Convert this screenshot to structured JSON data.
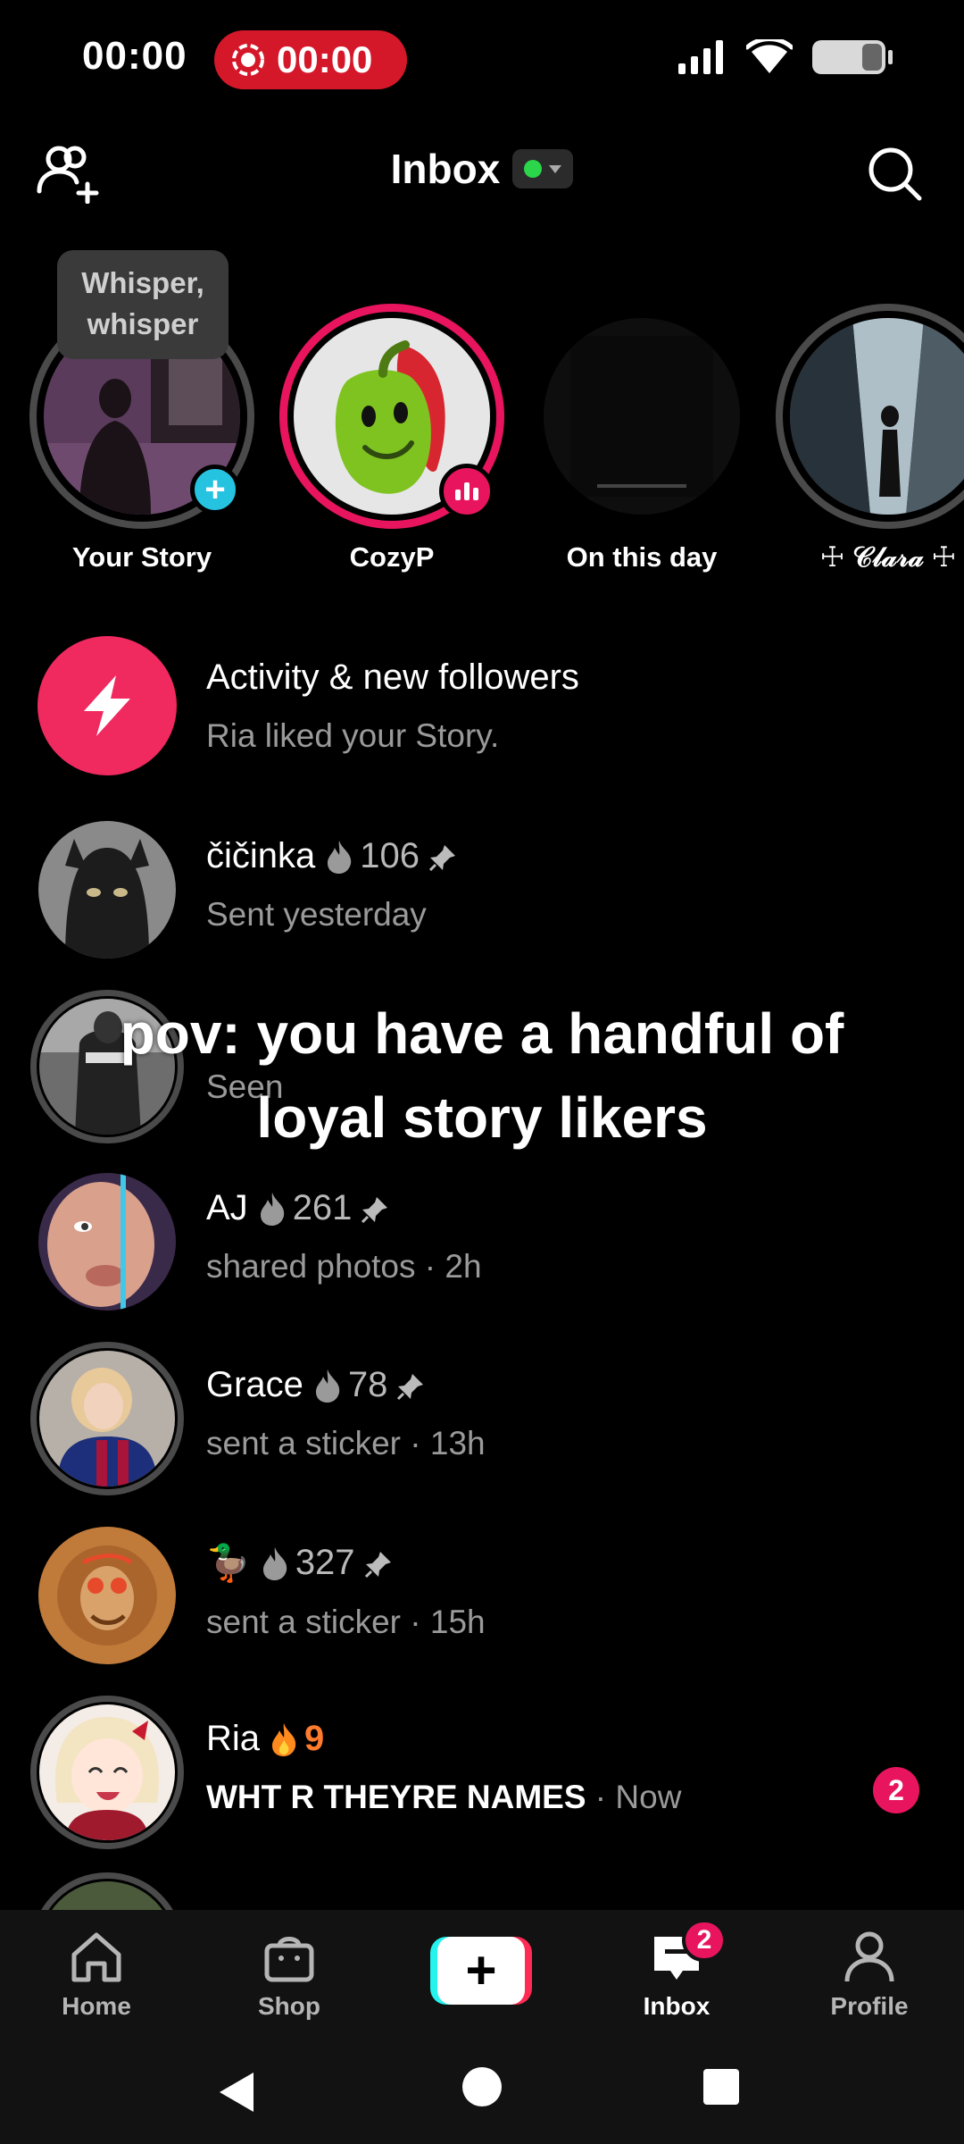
{
  "status_bar": {
    "time": "00:00",
    "recording_time": "00:00",
    "icons": [
      "signal-icon",
      "wifi-icon",
      "battery-icon"
    ]
  },
  "header": {
    "title": "Inbox",
    "status_color": "#2bd64b",
    "icons": [
      "add-friends-icon",
      "search-icon"
    ]
  },
  "stories": {
    "tooltip": "Whisper, whisper",
    "items": [
      {
        "name": "Your Story",
        "ring": "gray"
      },
      {
        "name": "CozyP",
        "ring": "pink"
      },
      {
        "name": "On this day",
        "ring": "none"
      },
      {
        "name": "☩ 𝒞𝓁𝒶𝓇𝒶 ☩",
        "ring": "gray"
      }
    ]
  },
  "activity": {
    "title": "Activity & new followers",
    "subtitle": "Ria liked your Story."
  },
  "conversations": [
    {
      "name": "čičinka",
      "streak": "106",
      "pinned": true,
      "subtitle": "Sent yesterday",
      "time": ""
    },
    {
      "name": "",
      "streak": "",
      "pinned": false,
      "subtitle": "Seen",
      "time": ""
    },
    {
      "name": "AJ",
      "streak": "261",
      "pinned": true,
      "subtitle": "shared photos",
      "time": "2h"
    },
    {
      "name": "Grace",
      "streak": "78",
      "pinned": true,
      "subtitle": "sent a sticker",
      "time": "13h"
    },
    {
      "name": "🦆",
      "streak": "327",
      "pinned": true,
      "subtitle": "sent a sticker",
      "time": "15h"
    },
    {
      "name": "Ria",
      "streak": "9",
      "pinned": false,
      "subtitle": "WHT R THEYRE NAMES",
      "time": "Now",
      "unread": "2"
    }
  ],
  "caption": {
    "line1": "pov: you have a handful of",
    "line2": "loyal story likers"
  },
  "bottom_nav": {
    "items": [
      {
        "label": "Home",
        "icon": "home-icon"
      },
      {
        "label": "Shop",
        "icon": "shop-icon"
      },
      {
        "label": "",
        "icon": "create-icon"
      },
      {
        "label": "Inbox",
        "icon": "inbox-icon",
        "badge": "2"
      },
      {
        "label": "Profile",
        "icon": "profile-icon"
      }
    ]
  },
  "colors": {
    "accent_pink": "#e8155e",
    "story_badge": "#26c3e0",
    "streak_active": "#ff7b2e"
  }
}
